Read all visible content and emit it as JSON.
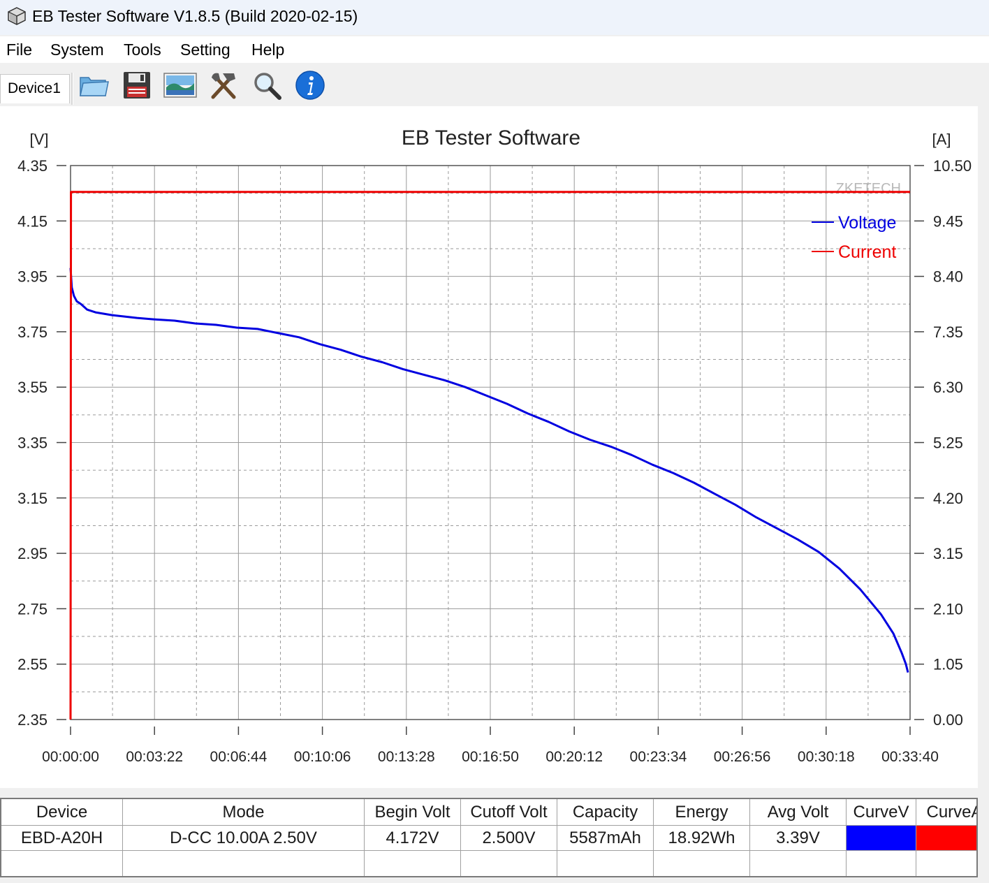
{
  "window": {
    "title": "EB Tester Software V1.8.5 (Build 2020-02-15)"
  },
  "menu": [
    "File",
    "System",
    "Tools",
    "Setting",
    "Help"
  ],
  "toolbar": {
    "device_tab": "Device1",
    "buttons": [
      {
        "name": "open-folder-button",
        "icon": "folder-icon"
      },
      {
        "name": "save-button",
        "icon": "floppy-disk-icon"
      },
      {
        "name": "picture-button",
        "icon": "landscape-picture-icon"
      },
      {
        "name": "tools-button",
        "icon": "hammer-wrench-icon"
      },
      {
        "name": "search-button",
        "icon": "magnifier-icon"
      },
      {
        "name": "info-button",
        "icon": "info-icon"
      }
    ]
  },
  "chart_data": {
    "type": "line",
    "title": "EB Tester Software",
    "watermark": "ZKETECH",
    "y_left_unit": "[V]",
    "y_right_unit": "[A]",
    "y_left_ticks": [
      "4.35",
      "4.15",
      "3.95",
      "3.75",
      "3.55",
      "3.35",
      "3.15",
      "2.95",
      "2.75",
      "2.55",
      "2.35"
    ],
    "y_right_ticks": [
      "10.50",
      "9.45",
      "8.40",
      "7.35",
      "6.30",
      "5.25",
      "4.20",
      "3.15",
      "2.10",
      "1.05",
      "0.00"
    ],
    "x_ticks": [
      "00:00:00",
      "00:03:22",
      "00:06:44",
      "00:10:06",
      "00:13:28",
      "00:16:50",
      "00:20:12",
      "00:23:34",
      "00:26:56",
      "00:30:18",
      "00:33:40"
    ],
    "xlim_seconds": [
      0,
      2020
    ],
    "ylim_left": [
      2.35,
      4.35
    ],
    "ylim_right": [
      0.0,
      10.5
    ],
    "grid": true,
    "legend_position": "top-right",
    "series": [
      {
        "name": "Voltage",
        "color": "#0000e0",
        "axis": "left",
        "x_seconds": [
          0,
          3,
          8,
          15,
          25,
          40,
          60,
          80,
          100,
          130,
          160,
          200,
          250,
          300,
          350,
          400,
          450,
          500,
          550,
          600,
          650,
          700,
          750,
          800,
          850,
          900,
          950,
          1000,
          1050,
          1100,
          1150,
          1200,
          1250,
          1300,
          1350,
          1400,
          1450,
          1500,
          1550,
          1600,
          1650,
          1700,
          1750,
          1800,
          1850,
          1900,
          1950,
          1980,
          2000,
          2010,
          2015
        ],
        "values": [
          3.98,
          3.91,
          3.88,
          3.86,
          3.85,
          3.83,
          3.82,
          3.815,
          3.81,
          3.805,
          3.8,
          3.795,
          3.79,
          3.78,
          3.775,
          3.765,
          3.76,
          3.745,
          3.73,
          3.705,
          3.685,
          3.66,
          3.64,
          3.615,
          3.595,
          3.575,
          3.55,
          3.52,
          3.49,
          3.455,
          3.425,
          3.39,
          3.36,
          3.335,
          3.305,
          3.27,
          3.24,
          3.205,
          3.165,
          3.125,
          3.08,
          3.04,
          3.0,
          2.955,
          2.895,
          2.82,
          2.73,
          2.66,
          2.59,
          2.55,
          2.52
        ]
      },
      {
        "name": "Current",
        "color": "#ee0000",
        "axis": "right",
        "x_seconds": [
          0,
          1,
          2020
        ],
        "values": [
          0.0,
          10.0,
          10.0
        ]
      }
    ]
  },
  "table": {
    "headers": [
      "Device",
      "Mode",
      "Begin Volt",
      "Cutoff Volt",
      "Capacity",
      "Energy",
      "Avg Volt",
      "CurveV",
      "CurveA"
    ],
    "rows": [
      [
        "EBD-A20H",
        "D-CC  10.00A  2.50V",
        "4.172V",
        "2.500V",
        "5587mAh",
        "18.92Wh",
        "3.39V"
      ]
    ],
    "curve_colors": [
      "#0000ff",
      "#ff0000"
    ]
  }
}
